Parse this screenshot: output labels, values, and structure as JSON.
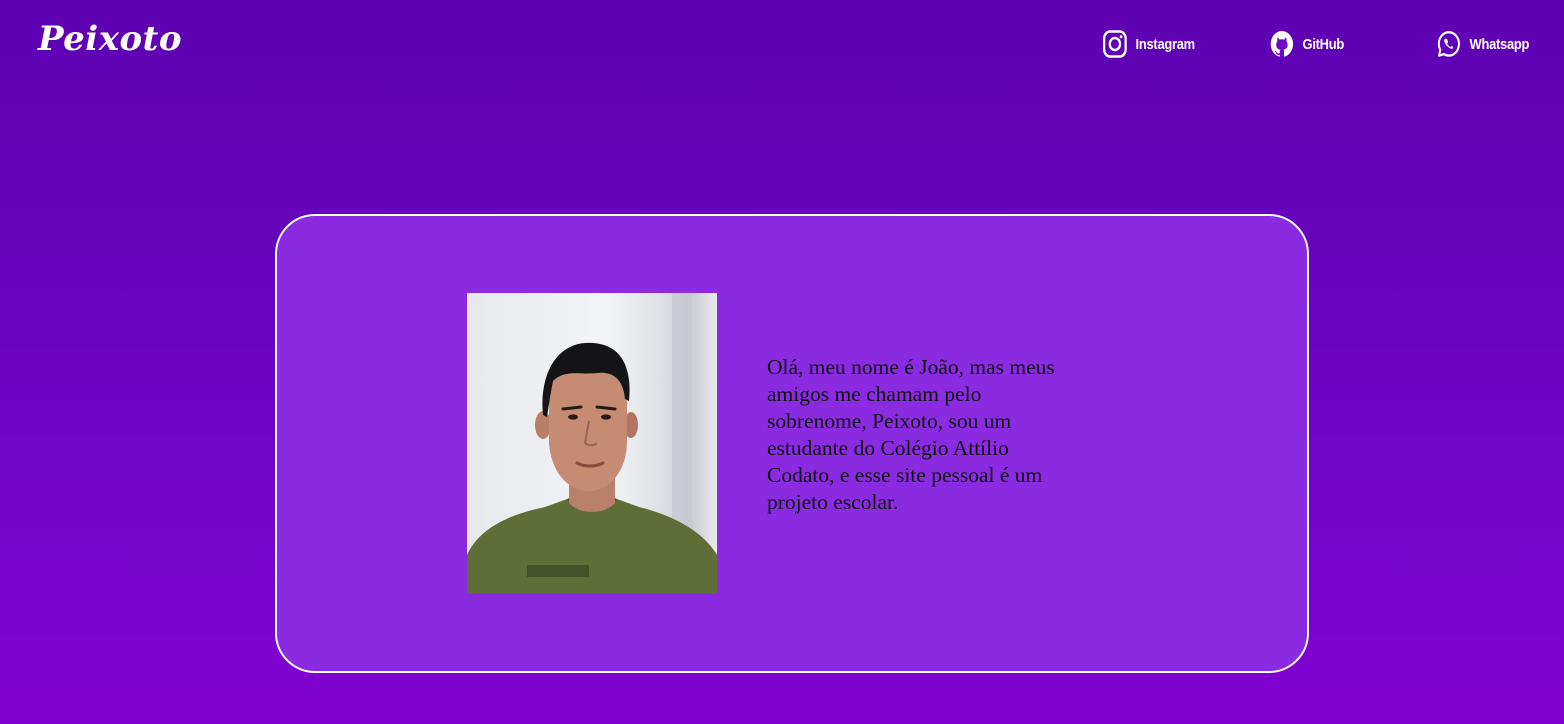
{
  "header": {
    "logo_text": "Peixoto"
  },
  "nav": {
    "links": [
      {
        "label": "Instagram",
        "icon": "instagram-icon"
      },
      {
        "label": "GitHub",
        "icon": "github-icon"
      },
      {
        "label": "Whatsapp",
        "icon": "whatsapp-icon"
      }
    ]
  },
  "main": {
    "photo_label": "profile-photo",
    "bio": "Olá, meu nome é João, mas meus amigos me chamam pelo sobrenome, Peixoto, sou um estudante do Colégio Attílio Codato, e esse site pessoal é um projeto escolar."
  },
  "colors": {
    "background_top": "#5d02b3",
    "background_bottom": "#8203d1",
    "card_background": "#8a2be2",
    "card_border": "#ffffff",
    "text_light": "#ffffff",
    "text_dark": "#111111"
  }
}
